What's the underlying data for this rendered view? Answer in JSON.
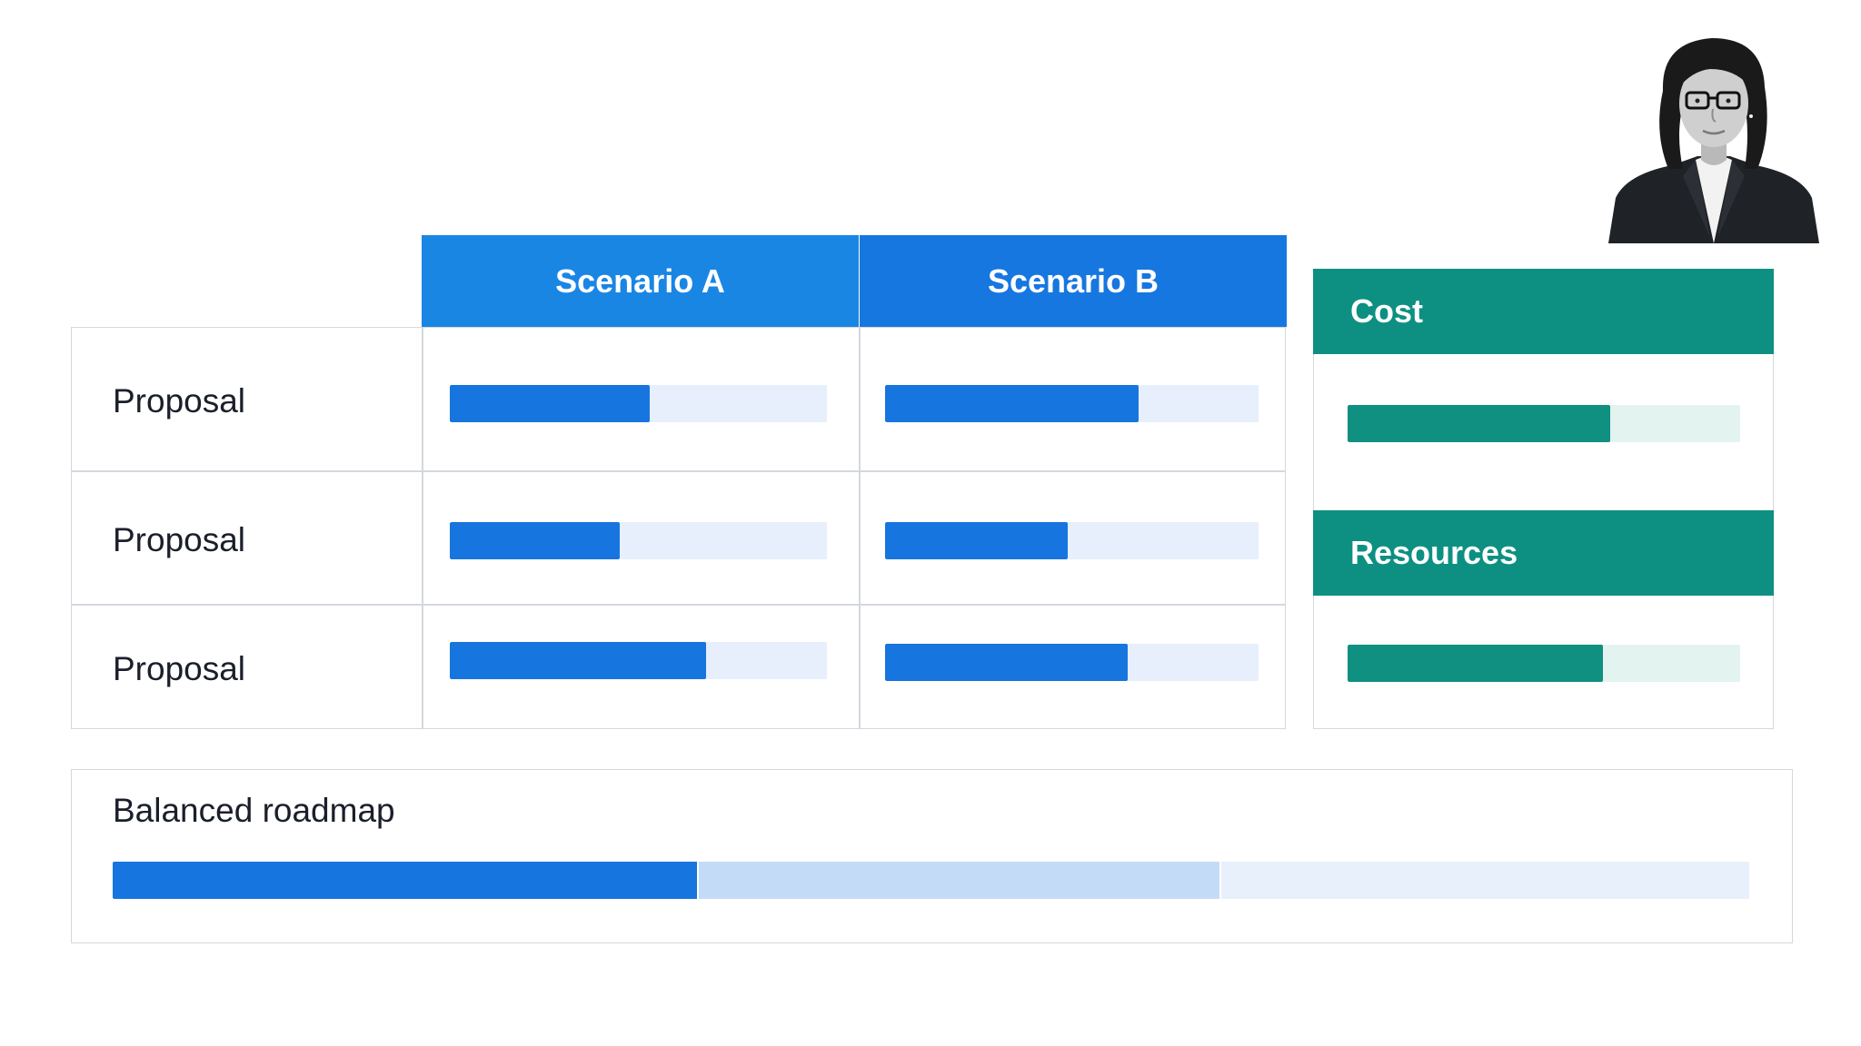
{
  "colors": {
    "primary_blue": "#1775df",
    "blue_track": "#e6effb",
    "teal": "#0d9082",
    "teal_track": "#e3f3f0",
    "roadmap_light": "#c4dbf8",
    "roadmap_track": "#e8f0fb"
  },
  "comparison": {
    "columns": [
      "Scenario A",
      "Scenario B"
    ],
    "rows": [
      {
        "label": "Proposal",
        "scenario_a": 0.53,
        "scenario_b": 0.68
      },
      {
        "label": "Proposal",
        "scenario_a": 0.45,
        "scenario_b": 0.49
      },
      {
        "label": "Proposal",
        "scenario_a": 0.68,
        "scenario_b": 0.65
      }
    ]
  },
  "side_panels": [
    {
      "title": "Cost",
      "value": 0.67
    },
    {
      "title": "Resources",
      "value": 0.65
    }
  ],
  "roadmap": {
    "title": "Balanced roadmap",
    "segments": [
      {
        "value": 0.357,
        "color": "#1775df"
      },
      {
        "value": 0.318,
        "color": "#c4dbf8"
      },
      {
        "value": 0.325,
        "color": "#e8f0fb"
      }
    ]
  },
  "presenter": {
    "icon": "presenter-photo"
  }
}
